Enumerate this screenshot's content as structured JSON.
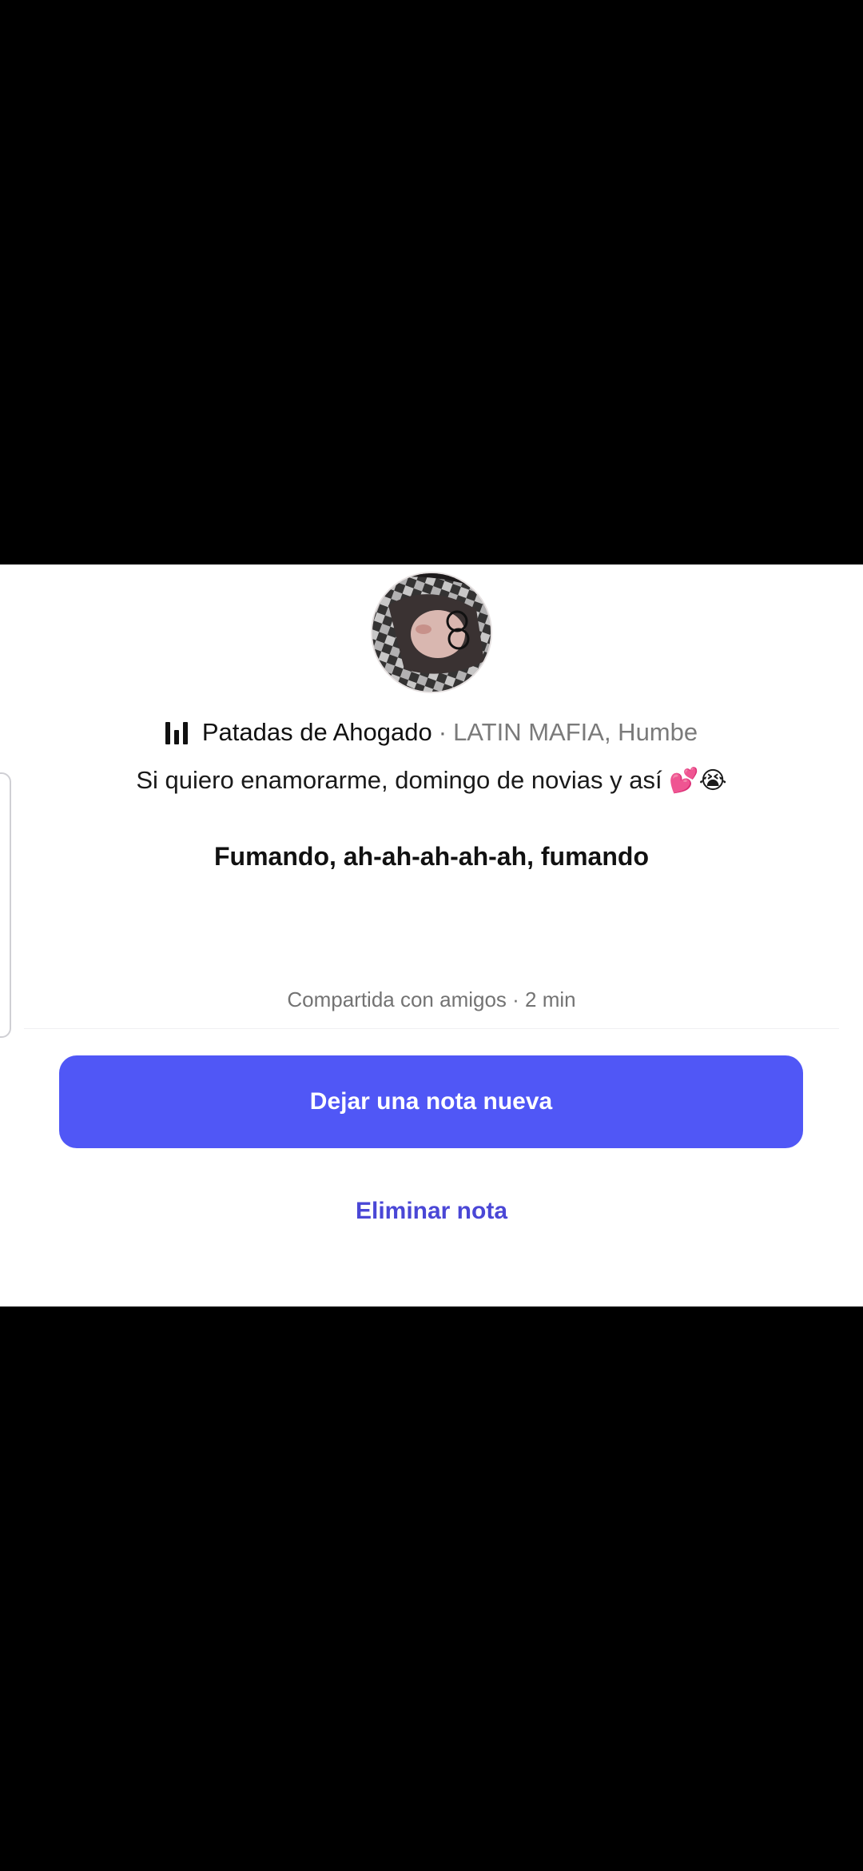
{
  "note": {
    "song": {
      "title": "Patadas de Ahogado",
      "separator": "·",
      "artist": "LATIN MAFIA, Humbe"
    },
    "text": "Si quiero enamorarme, domingo de novias y así",
    "emojis": "💕😭",
    "lyric": "Fumando, ah-ah-ah-ah-ah, fumando",
    "shared": "Compartida con amigos · 2 min"
  },
  "actions": {
    "new_note": "Dejar una nota nueva",
    "delete_note": "Eliminar nota"
  },
  "colors": {
    "primary_button": "#5057f6",
    "link": "#4a47d6",
    "background_overlay": "#000000",
    "sheet": "#ffffff"
  },
  "icons": {
    "music": "music-bars-icon"
  }
}
